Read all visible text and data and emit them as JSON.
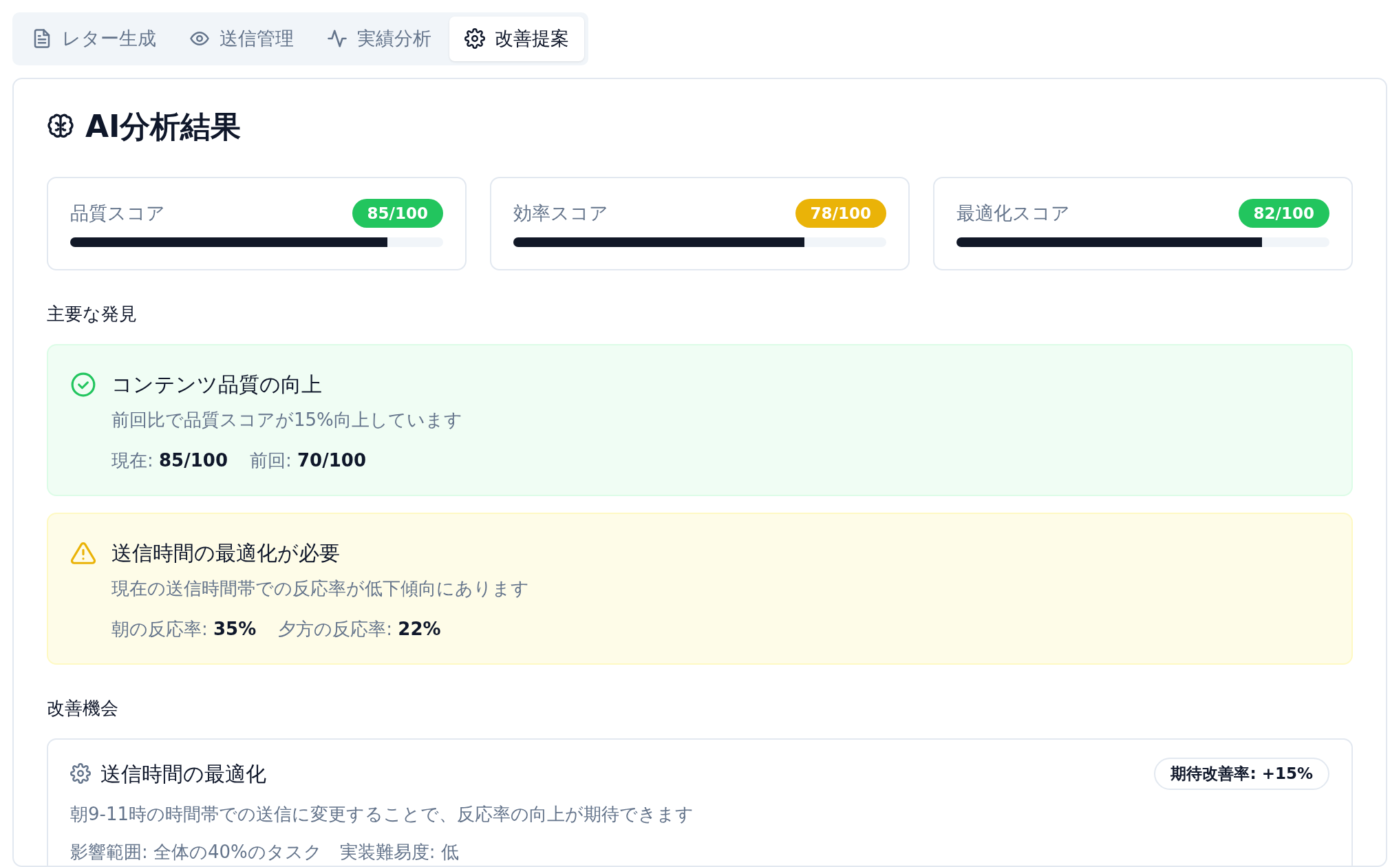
{
  "tabs": [
    {
      "label": "レター生成",
      "selected": false
    },
    {
      "label": "送信管理",
      "selected": false
    },
    {
      "label": "実績分析",
      "selected": false
    },
    {
      "label": "改善提案",
      "selected": true
    }
  ],
  "title": "AI分析結果",
  "scores": [
    {
      "label": "品質スコア",
      "value": "85/100",
      "color": "#22c55e",
      "level": 0.85
    },
    {
      "label": "効率スコア",
      "value": "78/100",
      "color": "#eab308",
      "level": 0.78
    },
    {
      "label": "最適化スコア",
      "value": "82/100",
      "color": "#22c55e",
      "level": 0.82
    }
  ],
  "findings_heading": "主要な発見",
  "findings": [
    {
      "kind": "success",
      "title": "コンテンツ品質の向上",
      "description": "前回比で品質スコアが15%向上しています",
      "stats": [
        {
          "label": "現在:",
          "value": "85/100"
        },
        {
          "label": "前回:",
          "value": "70/100"
        }
      ]
    },
    {
      "kind": "warning",
      "title": "送信時間の最適化が必要",
      "description": "現在の送信時間帯での反応率が低下傾向にあります",
      "stats": [
        {
          "label": "朝の反応率:",
          "value": "35%"
        },
        {
          "label": "夕方の反応率:",
          "value": "22%"
        }
      ]
    }
  ],
  "opportunities_heading": "改善機会",
  "opportunities": [
    {
      "title": "送信時間の最適化",
      "badge": "期待改善率: +15%",
      "description": "朝9-11時の時間帯での送信に変更することで、反応率の向上が期待できます",
      "details": [
        "影響範囲: 全体の40%のタスク",
        "実装難易度: 低"
      ]
    }
  ]
}
